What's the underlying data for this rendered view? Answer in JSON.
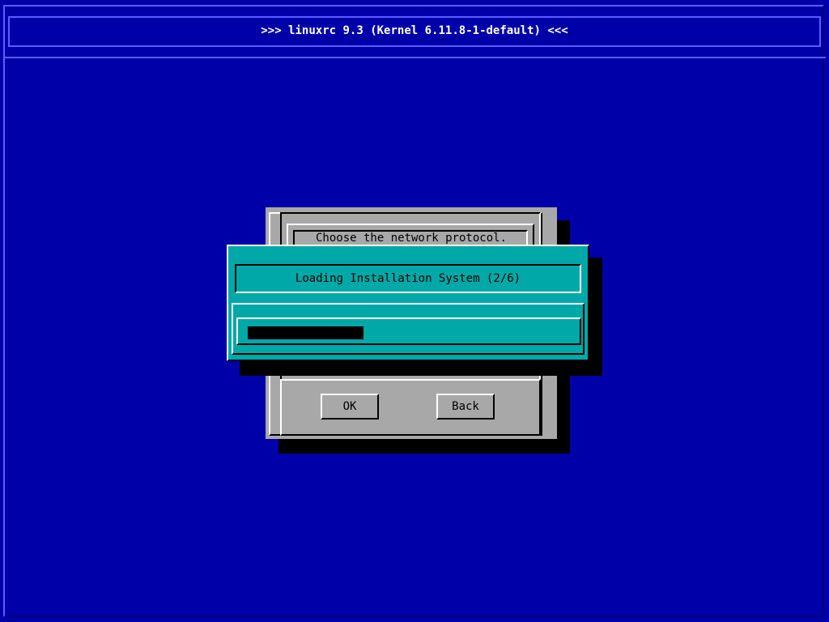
{
  "header": {
    "title": ">>> linuxrc 9.3 (Kernel 6.11.8-1-default) <<<"
  },
  "background_dialog": {
    "prompt": "Choose the network protocol.",
    "buttons": {
      "ok": "OK",
      "back": "Back"
    }
  },
  "progress_dialog": {
    "title": "Loading Installation System (2/6)",
    "progress": 0.36
  },
  "colors": {
    "desktop": "#0000a8",
    "dialog_gray": "#a8a8a8",
    "progress_dialog": "#00a8a8",
    "progress_fill": "#000000"
  }
}
